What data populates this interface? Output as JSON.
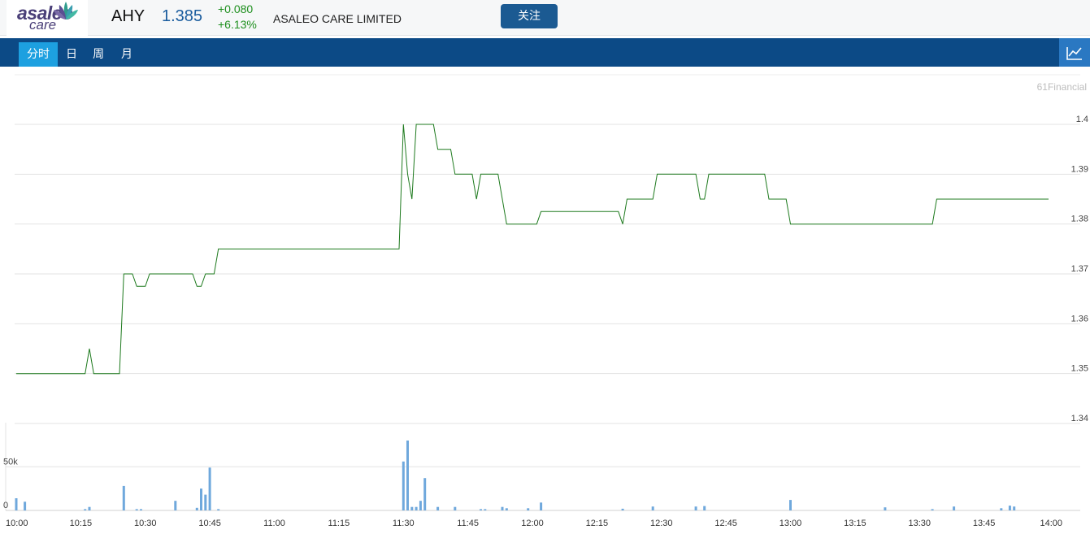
{
  "header": {
    "logo_line1": "asaleo",
    "logo_line2": "care",
    "ticker": "AHY",
    "price": "1.385",
    "change": "+0.080",
    "change_pct": "+6.13%",
    "company": "ASALEO CARE LIMITED",
    "follow_label": "关注"
  },
  "tabs": [
    {
      "label": "分时",
      "active": true
    },
    {
      "label": "日",
      "active": false
    },
    {
      "label": "周",
      "active": false
    },
    {
      "label": "月",
      "active": false
    }
  ],
  "chart_toggle_icon": "line-chart-icon",
  "colors": {
    "price_line": "#1e7a1e",
    "volume_bar": "#6fa8dc",
    "tab_bar": "#0c4a86",
    "active_tab": "#1da0e0",
    "up": "#1e8f1e"
  },
  "chart_data": {
    "type": "line",
    "watermark": "61Financial",
    "price_axis": {
      "ticks": [
        "1.4",
        "1.39",
        "1.38",
        "1.37",
        "1.36",
        "1.35",
        "1.34"
      ],
      "ylim": [
        1.34,
        1.4
      ]
    },
    "volume_axis": {
      "ticks": [
        "50k",
        "0"
      ]
    },
    "time_ticks": [
      "10:00",
      "10:15",
      "10:30",
      "10:45",
      "11:00",
      "11:15",
      "11:30",
      "11:45",
      "12:00",
      "12:15",
      "12:30",
      "12:45",
      "13:00",
      "13:15",
      "13:30",
      "13:45",
      "14:00"
    ],
    "price_series": [
      [
        "10:00",
        1.35
      ],
      [
        "10:16",
        1.35
      ],
      [
        "10:17",
        1.355
      ],
      [
        "10:18",
        1.35
      ],
      [
        "10:24",
        1.35
      ],
      [
        "10:25",
        1.37
      ],
      [
        "10:27",
        1.37
      ],
      [
        "10:28",
        1.3675
      ],
      [
        "10:30",
        1.3675
      ],
      [
        "10:31",
        1.37
      ],
      [
        "10:41",
        1.37
      ],
      [
        "10:42",
        1.3675
      ],
      [
        "10:43",
        1.3675
      ],
      [
        "10:44",
        1.37
      ],
      [
        "10:46",
        1.37
      ],
      [
        "10:47",
        1.375
      ],
      [
        "11:29",
        1.375
      ],
      [
        "11:30",
        1.4
      ],
      [
        "11:31",
        1.39
      ],
      [
        "11:32",
        1.385
      ],
      [
        "11:33",
        1.4
      ],
      [
        "11:37",
        1.4
      ],
      [
        "11:38",
        1.395
      ],
      [
        "11:41",
        1.395
      ],
      [
        "11:42",
        1.39
      ],
      [
        "11:46",
        1.39
      ],
      [
        "11:47",
        1.385
      ],
      [
        "11:48",
        1.39
      ],
      [
        "11:52",
        1.39
      ],
      [
        "11:54",
        1.38
      ],
      [
        "12:01",
        1.38
      ],
      [
        "12:02",
        1.3825
      ],
      [
        "12:20",
        1.3825
      ],
      [
        "12:21",
        1.38
      ],
      [
        "12:22",
        1.385
      ],
      [
        "12:28",
        1.385
      ],
      [
        "12:29",
        1.39
      ],
      [
        "12:38",
        1.39
      ],
      [
        "12:39",
        1.385
      ],
      [
        "12:40",
        1.385
      ],
      [
        "12:41",
        1.39
      ],
      [
        "12:54",
        1.39
      ],
      [
        "12:55",
        1.385
      ],
      [
        "12:59",
        1.385
      ],
      [
        "13:00",
        1.38
      ],
      [
        "13:33",
        1.38
      ],
      [
        "13:34",
        1.385
      ],
      [
        "14:00",
        1.385
      ]
    ],
    "volume_series": [
      [
        "10:00",
        14000
      ],
      [
        "10:02",
        10000
      ],
      [
        "10:16",
        1500
      ],
      [
        "10:17",
        4000
      ],
      [
        "10:25",
        28000
      ],
      [
        "10:28",
        1500
      ],
      [
        "10:29",
        1500
      ],
      [
        "10:37",
        11000
      ],
      [
        "10:42",
        3000
      ],
      [
        "10:43",
        25000
      ],
      [
        "10:44",
        18000
      ],
      [
        "10:45",
        49000
      ],
      [
        "10:47",
        1500
      ],
      [
        "11:30",
        56000
      ],
      [
        "11:31",
        80000
      ],
      [
        "11:32",
        4000
      ],
      [
        "11:33",
        4000
      ],
      [
        "11:34",
        11000
      ],
      [
        "11:35",
        37000
      ],
      [
        "11:38",
        4000
      ],
      [
        "11:42",
        4000
      ],
      [
        "11:48",
        1500
      ],
      [
        "11:49",
        1500
      ],
      [
        "11:53",
        4000
      ],
      [
        "11:54",
        2500
      ],
      [
        "11:59",
        2500
      ],
      [
        "12:02",
        9000
      ],
      [
        "12:21",
        2000
      ],
      [
        "12:28",
        4500
      ],
      [
        "12:38",
        4500
      ],
      [
        "12:40",
        5000
      ],
      [
        "13:00",
        12000
      ],
      [
        "13:22",
        3500
      ],
      [
        "13:33",
        1500
      ],
      [
        "13:38",
        4500
      ],
      [
        "13:49",
        2500
      ],
      [
        "13:51",
        5500
      ],
      [
        "13:52",
        4500
      ]
    ]
  }
}
